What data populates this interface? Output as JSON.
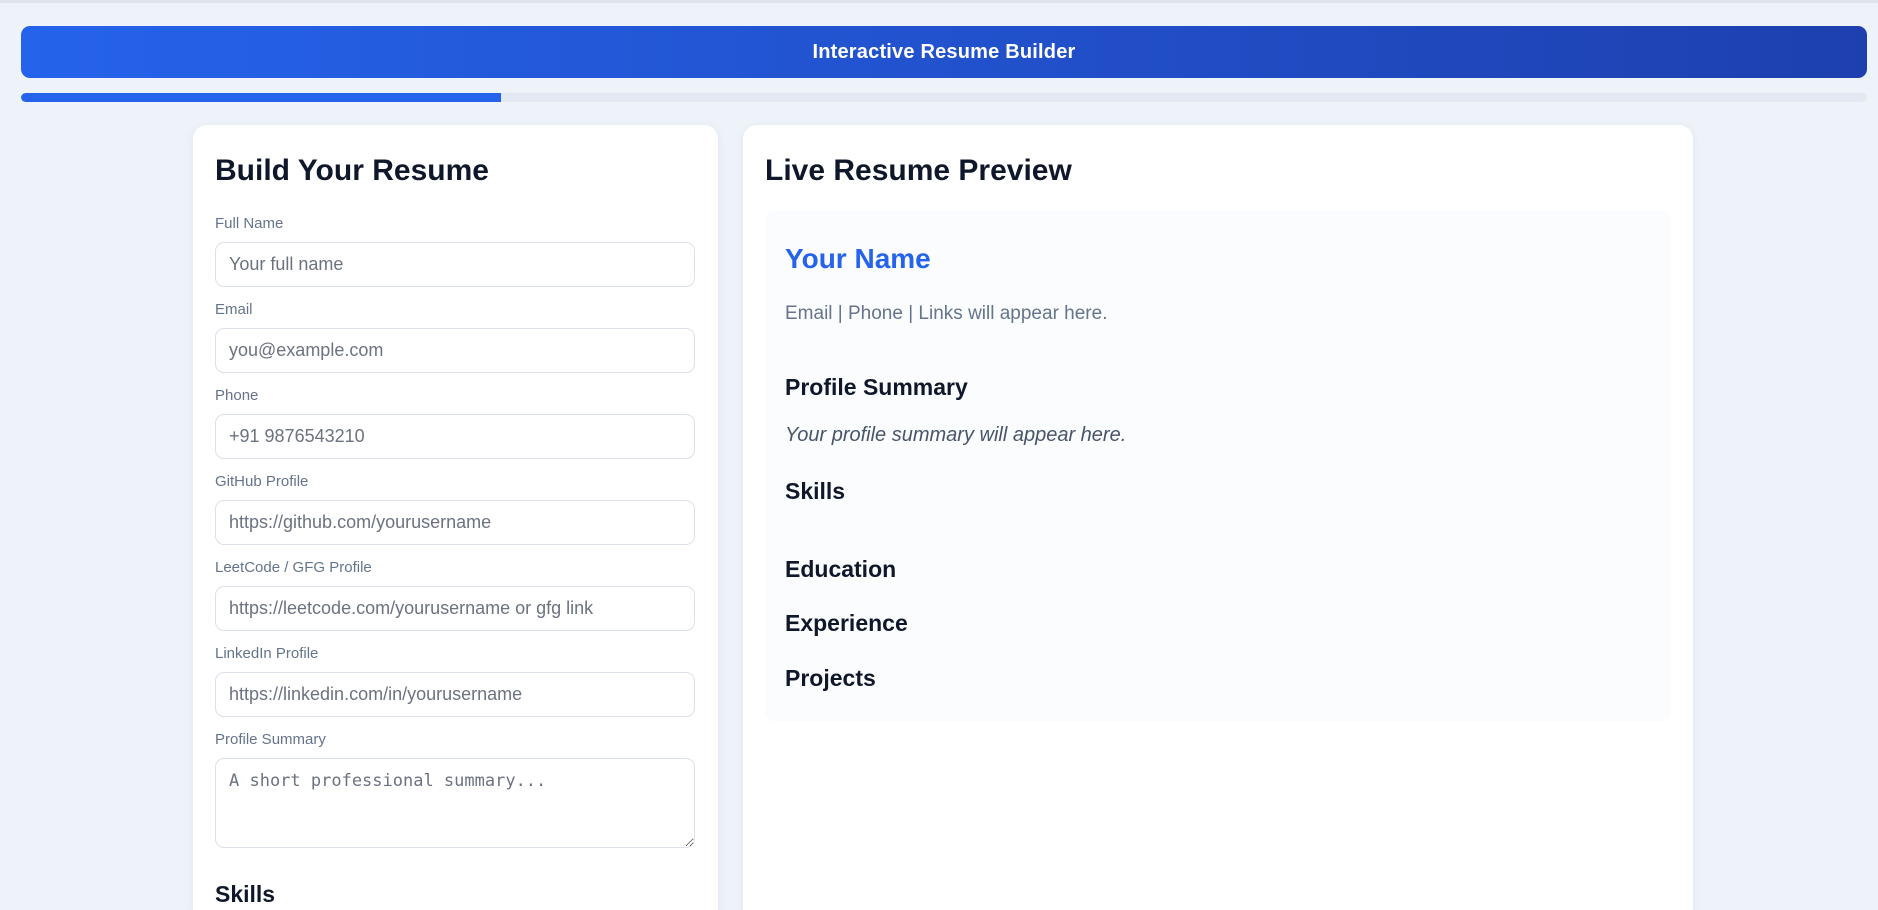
{
  "header": {
    "title": "Interactive Resume Builder"
  },
  "progress": {
    "fraction": 0.26
  },
  "colors": {
    "accent": "#2563eb",
    "accent_dark": "#1e40af",
    "background": "#eef2f9"
  },
  "form": {
    "title": "Build Your Resume",
    "fields": {
      "full_name": {
        "label": "Full Name",
        "placeholder": "Your full name",
        "value": ""
      },
      "email": {
        "label": "Email",
        "placeholder": "you@example.com",
        "value": ""
      },
      "phone": {
        "label": "Phone",
        "placeholder": "+91 9876543210",
        "value": ""
      },
      "github": {
        "label": "GitHub Profile",
        "placeholder": "https://github.com/yourusername",
        "value": ""
      },
      "leetcode": {
        "label": "LeetCode / GFG Profile",
        "placeholder": "https://leetcode.com/yourusername or gfg link",
        "value": ""
      },
      "linkedin": {
        "label": "LinkedIn Profile",
        "placeholder": "https://linkedin.com/in/yourusername",
        "value": ""
      },
      "summary": {
        "label": "Profile Summary",
        "placeholder": "A short professional summary...",
        "value": ""
      }
    },
    "skills_heading": "Skills"
  },
  "preview": {
    "title": "Live Resume Preview",
    "name": "Your Name",
    "contact": "Email | Phone | Links will appear here.",
    "summary_heading": "Profile Summary",
    "summary_text": "Your profile summary will appear here.",
    "skills_heading": "Skills",
    "education_heading": "Education",
    "experience_heading": "Experience",
    "projects_heading": "Projects"
  }
}
